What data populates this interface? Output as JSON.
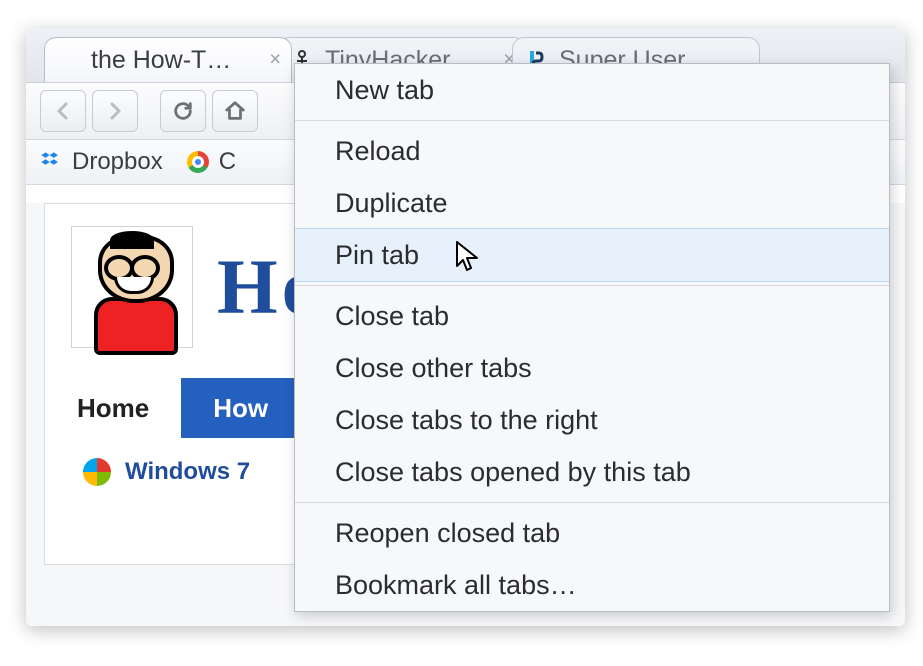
{
  "tabs": [
    {
      "title": "the How-T…",
      "active": true
    },
    {
      "title": "TinyHacker…",
      "active": false
    },
    {
      "title": "Super User",
      "active": false
    }
  ],
  "bookmarks": [
    {
      "label": "Dropbox",
      "icon": "dropbox"
    },
    {
      "label": "C",
      "icon": "chrome"
    }
  ],
  "page": {
    "heroTitle": "How",
    "nav": [
      {
        "label": "Home",
        "key": "home"
      },
      {
        "label": "How",
        "key": "howto"
      }
    ],
    "subnav": {
      "label": "Windows 7"
    }
  },
  "contextMenu": {
    "groups": [
      [
        "New tab"
      ],
      [
        "Reload",
        "Duplicate",
        "Pin tab"
      ],
      [
        "Close tab",
        "Close other tabs",
        "Close tabs to the right",
        "Close tabs opened by this tab"
      ],
      [
        "Reopen closed tab",
        "Bookmark all tabs…"
      ]
    ],
    "hoverIndex": 3
  }
}
